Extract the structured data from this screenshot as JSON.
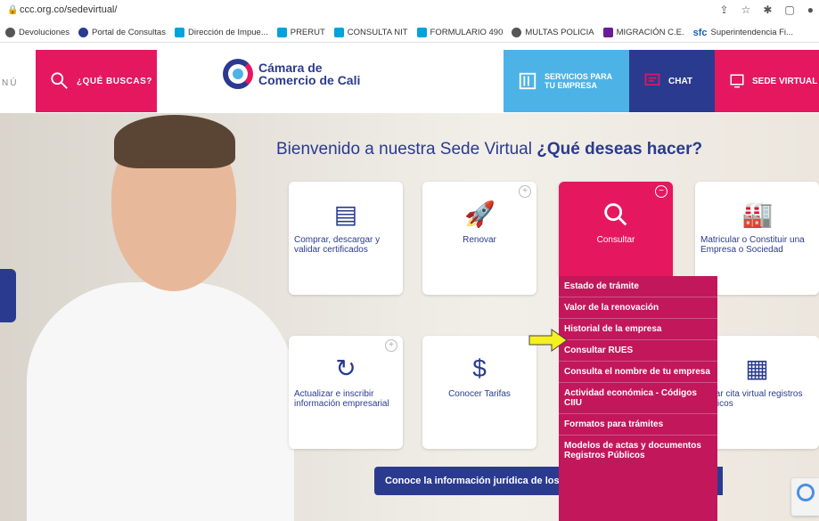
{
  "browser": {
    "url": "ccc.org.co/sedevirtual/",
    "bookmarks": [
      {
        "label": "Devoluciones",
        "color": "#555555"
      },
      {
        "label": "Portal de Consultas",
        "color": "#2a3b8f"
      },
      {
        "label": "Dirección de Impue...",
        "color": "#00a3d9"
      },
      {
        "label": "PRERUT",
        "color": "#00a3d9"
      },
      {
        "label": "CONSULTA NIT",
        "color": "#00a3d9"
      },
      {
        "label": "FORMULARIO 490",
        "color": "#00a3d9"
      },
      {
        "label": "MULTAS POLICIA",
        "color": "#555555"
      },
      {
        "label": "MIGRACIÓN C.E.",
        "color": "#6a1b9a"
      },
      {
        "label": "Superintendencia Fi...",
        "color": "#1a5fb4"
      }
    ],
    "sfc_mark": "sfc"
  },
  "header": {
    "menu_stub": "NÚ",
    "search_label": "¿QUÉ BUSCAS?",
    "logo_line1": "Cámara de",
    "logo_line2": "Comercio de Cali",
    "services_line1": "SERVICIOS PARA",
    "services_line2": "TU EMPRESA",
    "chat_label": "CHAT",
    "sede_label": "SEDE VIRTUAL"
  },
  "hero": {
    "welcome_text": "Bienvenido a nuestra Sede Virtual ",
    "welcome_bold": "¿Qué deseas hacer?"
  },
  "cards": {
    "c1": {
      "label": "Comprar, descargar y validar certificados",
      "icon": "document-icon"
    },
    "c2": {
      "label": "Renovar",
      "icon": "rocket-icon"
    },
    "c3": {
      "label": "Consultar",
      "icon": "search-icon"
    },
    "c4": {
      "label": "Matricular o Constituir una Empresa o Sociedad",
      "icon": "factory-icon"
    },
    "c5": {
      "label": "Actualizar e inscribir información empresarial",
      "icon": "user-refresh-icon"
    },
    "c6": {
      "label": "Conocer Tarifas",
      "icon": "dollar-icon"
    },
    "c7": {
      "label": "endar cita virtual registros públicos",
      "icon": "calendar-icon"
    }
  },
  "dropdown": [
    "Estado de trámite",
    "Valor de la renovación",
    "Historial de la empresa",
    "Consultar RUES",
    "Consulta el nombre de tu empresa",
    "Actividad económica - Códigos CIIU",
    "Formatos para trámites",
    "Modelos de actas y documentos Registros Públicos"
  ],
  "banner": {
    "label": "Conoce la información jurídica de los"
  },
  "colors": {
    "pink": "#e5175f",
    "navy": "#2a3b8f",
    "sky": "#4db3e6",
    "menu": "#c2185b"
  }
}
